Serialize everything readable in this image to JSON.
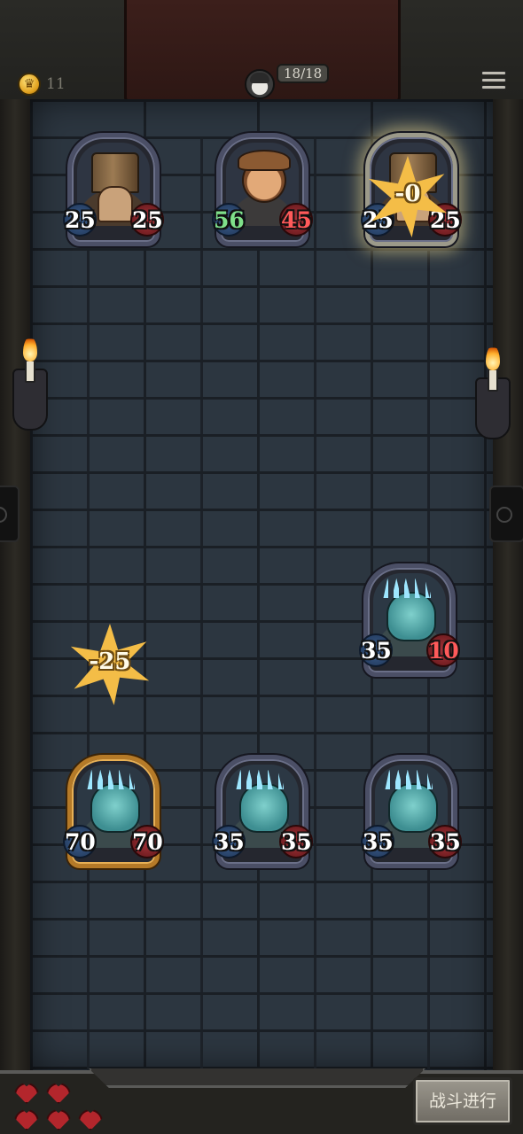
{
  "hud": {
    "coins": "11",
    "deck_count": "18/18"
  },
  "player_row": [
    {
      "kind": "bucket",
      "attack": "25",
      "health": "25",
      "frame": "normal"
    },
    {
      "kind": "gnome",
      "attack": "56",
      "health": "45",
      "frame": "normal",
      "attack_buffed": true,
      "health_damaged": true
    },
    {
      "kind": "bucket",
      "attack": "25",
      "health": "25",
      "frame": "highlighted"
    }
  ],
  "enemy_front": [
    {
      "kind": "ghoul",
      "attack": "35",
      "health": "10",
      "health_damaged": true
    }
  ],
  "enemy_back": [
    {
      "kind": "ghoul",
      "attack": "70",
      "health": "70",
      "frame": "gold"
    },
    {
      "kind": "ghoul",
      "attack": "35",
      "health": "35",
      "frame": "normal"
    },
    {
      "kind": "ghoul",
      "attack": "35",
      "health": "35",
      "frame": "normal"
    }
  ],
  "damage_popups": {
    "player_card_3": "-0",
    "enemy_zone": "-25"
  },
  "lives": {
    "hearts": 5
  },
  "battle_button": {
    "label": "战斗进行"
  },
  "colors": {
    "attack_badge": "#2d4a74",
    "health_badge": "#8a2428",
    "damage_star": "#f4bd47",
    "wall": "#2c3640"
  }
}
